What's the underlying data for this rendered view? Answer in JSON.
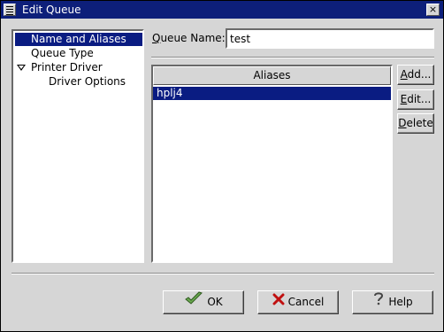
{
  "window": {
    "title": "Edit Queue",
    "close_glyph": "×"
  },
  "tree": {
    "items": [
      {
        "label": "Name and Aliases",
        "selected": true
      },
      {
        "label": "Queue Type"
      },
      {
        "label": "Printer Driver",
        "expanded": true
      },
      {
        "label": "Driver Options"
      }
    ]
  },
  "queue": {
    "label": "Queue Name:",
    "accel": "Q",
    "rest": "ueue Name:",
    "value": "test"
  },
  "aliases": {
    "header": "Aliases",
    "rows": [
      "hplj4"
    ]
  },
  "side_buttons": {
    "add": {
      "accel": "A",
      "rest": "dd..."
    },
    "edit": {
      "accel": "E",
      "rest": "dit..."
    },
    "delete": {
      "accel": "D",
      "rest": "elete"
    }
  },
  "bottom_buttons": {
    "ok": "OK",
    "cancel": "Cancel",
    "help": "Help"
  },
  "icons": {
    "ok": "check-arrow-icon",
    "cancel": "red-x-icon",
    "help": "question-icon"
  },
  "colors": {
    "titlebar": "#0d1f7a",
    "selection": "#0a1c82",
    "window_bg": "#d6d6d6"
  }
}
